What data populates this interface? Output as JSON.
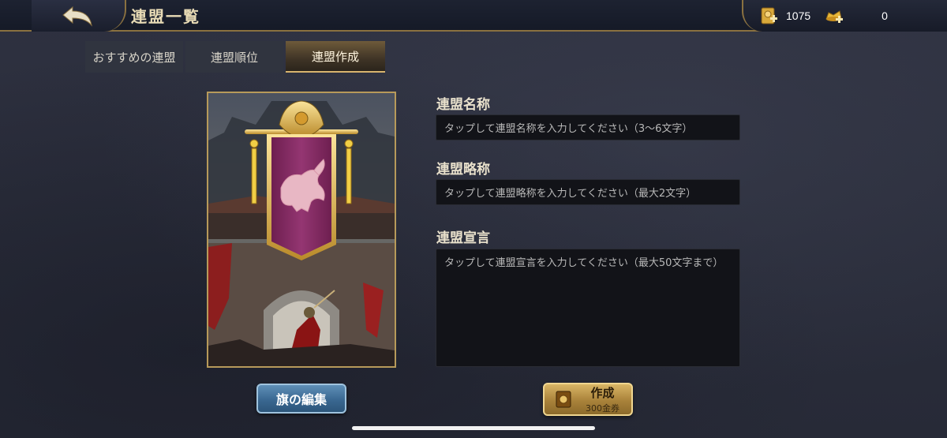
{
  "header": {
    "title": "連盟一覧",
    "back_icon": "back-arrow-icon",
    "resources": [
      {
        "name": "alliance-coupon",
        "icon": "coupon-plus-icon",
        "value": "1075"
      },
      {
        "name": "gold-ingot",
        "icon": "ingot-plus-icon",
        "value": "0"
      }
    ]
  },
  "tabs": [
    {
      "label": "おすすめの連盟",
      "active": false
    },
    {
      "label": "連盟順位",
      "active": false
    },
    {
      "label": "連盟作成",
      "active": true
    }
  ],
  "flag_panel": {
    "edit_button": "旗の編集"
  },
  "form": {
    "name": {
      "label": "連盟名称",
      "placeholder": "タップして連盟名称を入力してください（3〜6文字）"
    },
    "short_name": {
      "label": "連盟略称",
      "placeholder": "タップして連盟略称を入力してください（最大2文字）"
    },
    "declaration": {
      "label": "連盟宣言",
      "placeholder": "タップして連盟宣言を入力してください（最大50文字まで）"
    }
  },
  "create_button": {
    "label": "作成",
    "cost": "300金券"
  },
  "colors": {
    "gold_accent": "#b79a5a",
    "banner_purple": "#8a2e66",
    "create_gold": "#c9a352",
    "edit_blue": "#3a6891"
  }
}
